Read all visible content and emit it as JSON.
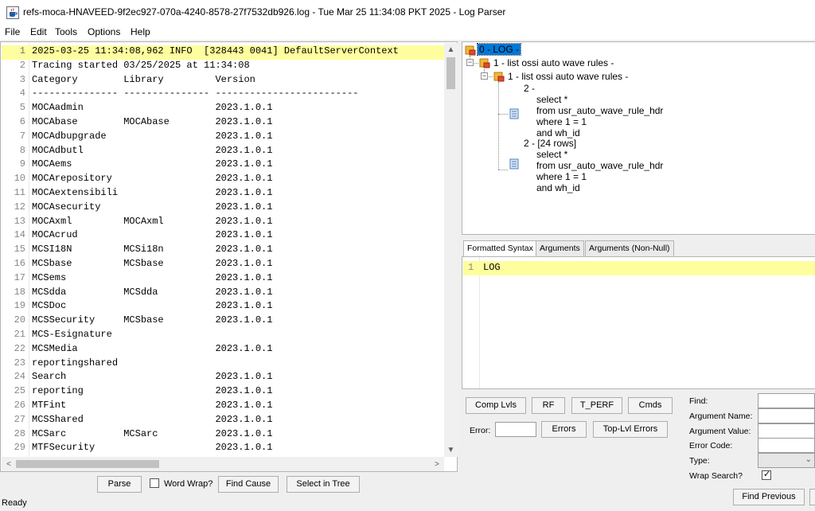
{
  "window": {
    "title": "refs-moca-HNAVEED-9f2ec927-070a-4240-8578-27f7532db926.log - Tue Mar 25 11:34:08 PKT 2025 - Log Parser",
    "app_icon": "java-cup-icon"
  },
  "menu": [
    "File",
    "Edit",
    "Tools",
    "Options",
    "Help"
  ],
  "log_lines": [
    {
      "n": "1",
      "text": "2025-03-25 11:34:08,962 INFO  [328443 0041] DefaultServerContext"
    },
    {
      "n": "2",
      "text": "Tracing started 03/25/2025 at 11:34:08"
    },
    {
      "n": "3",
      "text": "Category        Library         Version"
    },
    {
      "n": "4",
      "text": "--------------- --------------- -------------------------"
    },
    {
      "n": "5",
      "text": "MOCAadmin                       2023.1.0.1"
    },
    {
      "n": "6",
      "text": "MOCAbase        MOCAbase        2023.1.0.1"
    },
    {
      "n": "7",
      "text": "MOCAdbupgrade                   2023.1.0.1"
    },
    {
      "n": "8",
      "text": "MOCAdbutl                       2023.1.0.1"
    },
    {
      "n": "9",
      "text": "MOCAems                         2023.1.0.1"
    },
    {
      "n": "10",
      "text": "MOCArepository                  2023.1.0.1"
    },
    {
      "n": "11",
      "text": "MOCAextensibili                 2023.1.0.1"
    },
    {
      "n": "12",
      "text": "MOCAsecurity                    2023.1.0.1"
    },
    {
      "n": "13",
      "text": "MOCAxml         MOCAxml         2023.1.0.1"
    },
    {
      "n": "14",
      "text": "MOCAcrud                        2023.1.0.1"
    },
    {
      "n": "15",
      "text": "MCSI18N         MCSi18n         2023.1.0.1"
    },
    {
      "n": "16",
      "text": "MCSbase         MCSbase         2023.1.0.1"
    },
    {
      "n": "17",
      "text": "MCSems                          2023.1.0.1"
    },
    {
      "n": "18",
      "text": "MCSdda          MCSdda          2023.1.0.1"
    },
    {
      "n": "19",
      "text": "MCSDoc                          2023.1.0.1"
    },
    {
      "n": "20",
      "text": "MCSSecurity     MCSbase         2023.1.0.1"
    },
    {
      "n": "21",
      "text": "MCS-Esignature"
    },
    {
      "n": "22",
      "text": "MCSMedia                        2023.1.0.1"
    },
    {
      "n": "23",
      "text": "reportingshared"
    },
    {
      "n": "24",
      "text": "Search                          2023.1.0.1"
    },
    {
      "n": "25",
      "text": "reporting                       2023.1.0.1"
    },
    {
      "n": "26",
      "text": "MTFint                          2023.1.0.1"
    },
    {
      "n": "27",
      "text": "MCSShared                       2023.1.0.1"
    },
    {
      "n": "28",
      "text": "MCSarc          MCSarc          2023.1.0.1"
    },
    {
      "n": "29",
      "text": "MTFSecurity                     2023.1.0.1"
    }
  ],
  "left_buttons": {
    "parse": "Parse",
    "word_wrap": "Word Wrap?",
    "find_cause": "Find Cause",
    "select_in_tree": "Select in Tree"
  },
  "status": "Ready",
  "tree": {
    "root": "0 - LOG -",
    "node1": "1 - list ossi auto wave rules -",
    "node1_child": "1 - list ossi auto wave rules -",
    "leaf1_label": "2 -",
    "leaf1_lines": [
      "select *",
      "from usr_auto_wave_rule_hdr",
      "where 1 = 1",
      "and wh_id"
    ],
    "leaf2_label": "2 - [24 rows]",
    "leaf2_lines": [
      "select *",
      "from usr_auto_wave_rule_hdr",
      "where 1 = 1",
      "and wh_id"
    ]
  },
  "tabs": [
    "Formatted Syntax",
    "Arguments",
    "Arguments (Non-Null)"
  ],
  "syntax": {
    "line_number": "1",
    "text": "LOG"
  },
  "controls": {
    "comp_lvls": "Comp Lvls",
    "rf": "RF",
    "t_perf": "T_PERF",
    "cmds": "Cmds",
    "error_label": "Error:",
    "errors": "Errors",
    "top_lvl_errors": "Top-Lvl Errors"
  },
  "search": {
    "find": "Find:",
    "argument_name": "Argument Name:",
    "argument_value": "Argument Value:",
    "error_code": "Error Code:",
    "type": "Type:",
    "wrap_search": "Wrap Search?",
    "wrap_search_checked": true,
    "find_previous": "Find Previous"
  },
  "colors": {
    "highlight_line": "#fffe9e",
    "tree_selection": "#0078d7"
  }
}
